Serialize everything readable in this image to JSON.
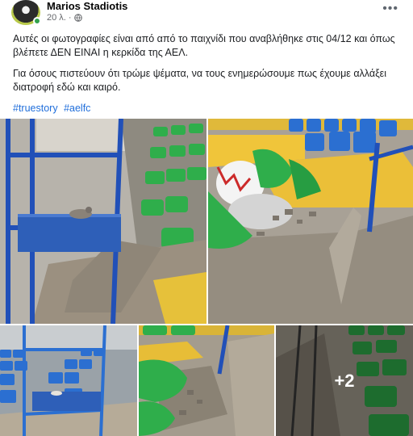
{
  "post": {
    "author": "Marios Stadiotis",
    "time": "20 λ.",
    "visibility_icon": "globe-icon",
    "more_label": "•••",
    "paragraphs": [
      "Αυτές οι φωτογραφίες είναι από από το παιχνίδι που αναβλήθηκε στις 04/12 και όπως βλέπετε ΔΕΝ ΕΙΝΑΙ η κερκίδα της ΑΕΛ.",
      "Για όσους πιστεύουν ότι τρώμε ψέματα, να τους ενημερώσουμε πως έχουμε αλλάξει διατροφή εδώ και καιρό."
    ],
    "hashtags": [
      "#truestory",
      "#aelfc"
    ]
  },
  "photos": {
    "more_count": "+2"
  },
  "colors": {
    "link": "#216fdb",
    "seat_green": "#2fae4b",
    "seat_blue": "#2b6fd1",
    "seat_yellow": "#f0c53a",
    "frame_blue": "#2150b8"
  }
}
